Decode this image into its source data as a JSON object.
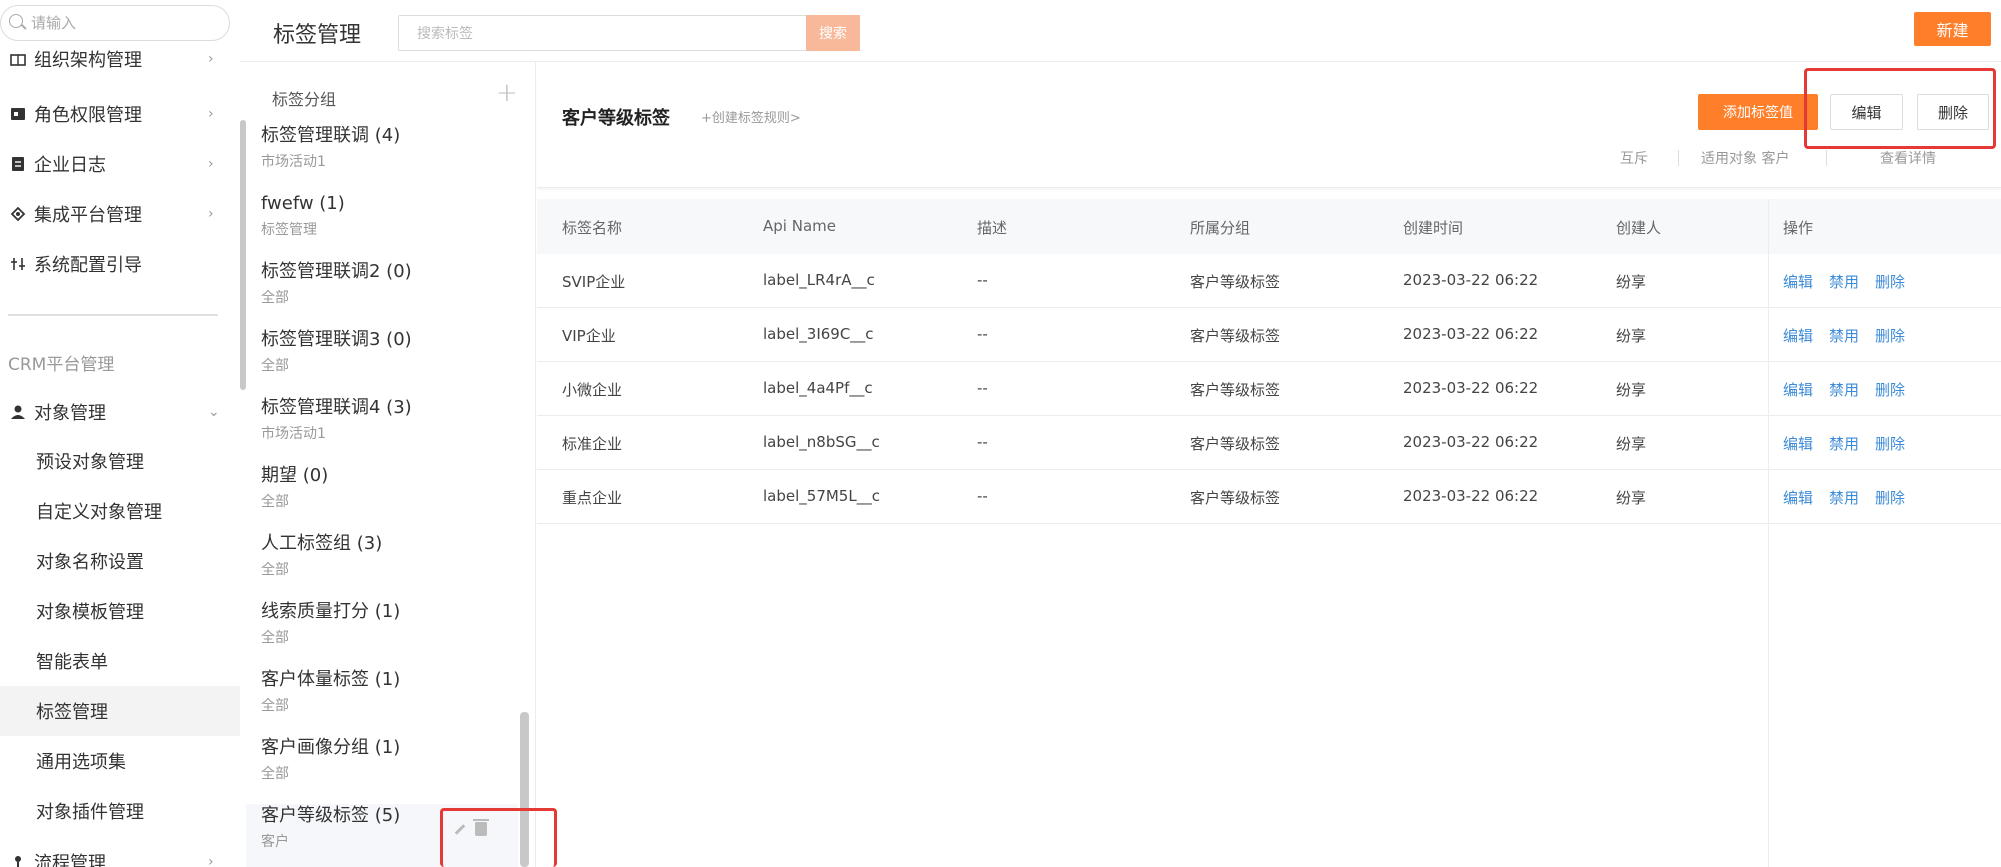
{
  "sidebar": {
    "search_placeholder": "请输入",
    "items": [
      {
        "label": "组织架构管理",
        "icon": "org-icon"
      },
      {
        "label": "角色权限管理",
        "icon": "role-icon"
      },
      {
        "label": "企业日志",
        "icon": "log-icon"
      },
      {
        "label": "集成平台管理",
        "icon": "integration-icon"
      },
      {
        "label": "系统配置引导",
        "icon": "config-icon"
      }
    ],
    "section_title": "CRM平台管理",
    "object_mgmt": {
      "label": "对象管理",
      "icon": "user-icon"
    },
    "sub_items": [
      "预设对象管理",
      "自定义对象管理",
      "对象名称设置",
      "对象模板管理",
      "智能表单",
      "标签管理",
      "通用选项集",
      "对象插件管理"
    ],
    "process_mgmt": {
      "label": "流程管理",
      "icon": "process-icon"
    }
  },
  "header": {
    "title": "标签管理",
    "search_placeholder": "搜索标签",
    "search_button": "搜索",
    "new_button": "新建"
  },
  "groups": {
    "header": "标签分组",
    "items": [
      {
        "name": "标签管理联调 (4)",
        "desc": "市场活动1"
      },
      {
        "name": "fwefw (1)",
        "desc": "标签管理"
      },
      {
        "name": "标签管理联调2 (0)",
        "desc": "全部"
      },
      {
        "name": "标签管理联调3 (0)",
        "desc": "全部"
      },
      {
        "name": "标签管理联调4 (3)",
        "desc": "市场活动1"
      },
      {
        "name": "期望 (0)",
        "desc": "全部"
      },
      {
        "name": "人工标签组 (3)",
        "desc": "全部"
      },
      {
        "name": "线索质量打分 (1)",
        "desc": "全部"
      },
      {
        "name": "客户体量标签 (1)",
        "desc": "全部"
      },
      {
        "name": "客户画像分组 (1)",
        "desc": "全部"
      },
      {
        "name": "客户等级标签 (5)",
        "desc": "客户"
      }
    ]
  },
  "detail": {
    "title": "客户等级标签",
    "rule_link": "+创建标签规则>",
    "add_value_button": "添加标签值",
    "edit_button": "编辑",
    "delete_button": "删除",
    "meta": {
      "mutex": "互斥",
      "applies": "适用对象 客户",
      "details": "查看详情"
    }
  },
  "table": {
    "headers": [
      "标签名称",
      "Api Name",
      "描述",
      "所属分组",
      "创建时间",
      "创建人",
      "操作"
    ],
    "rows": [
      [
        "SVIP企业",
        "label_LR4rA__c",
        "--",
        "客户等级标签",
        "2023-03-22 06:22",
        "纷享"
      ],
      [
        "VIP企业",
        "label_3I69C__c",
        "--",
        "客户等级标签",
        "2023-03-22 06:22",
        "纷享"
      ],
      [
        "小微企业",
        "label_4a4Pf__c",
        "--",
        "客户等级标签",
        "2023-03-22 06:22",
        "纷享"
      ],
      [
        "标准企业",
        "label_n8bSG__c",
        "--",
        "客户等级标签",
        "2023-03-22 06:22",
        "纷享"
      ],
      [
        "重点企业",
        "label_57M5L__c",
        "--",
        "客户等级标签",
        "2023-03-22 06:22",
        "纷享"
      ]
    ],
    "ops": [
      "编辑",
      "禁用",
      "删除"
    ]
  }
}
